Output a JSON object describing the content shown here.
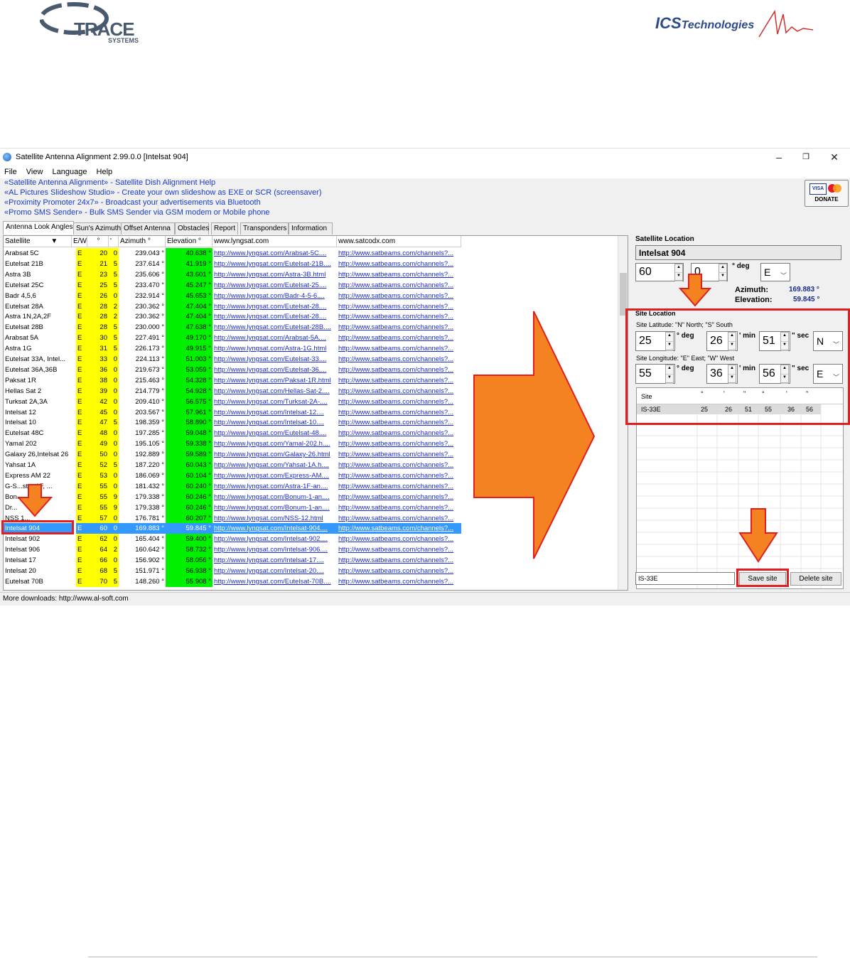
{
  "logos": {
    "trace_name": "TRACE",
    "trace_sub": "SYSTEMS",
    "ics_main": "ICS",
    "ics_rest": "Technologies"
  },
  "window": {
    "title": "Satellite Antenna Alignment 2.99.0.0 [Intelsat 904]",
    "controls": [
      "–",
      "❐",
      "✕"
    ]
  },
  "menu": [
    "File",
    "View",
    "Language",
    "Help"
  ],
  "promos": [
    "«Satellite Antenna Alignment» - Satellite Dish Alignment Help",
    "«AL Pictures Slideshow Studio» - Create your own slideshow as EXE or SCR (screensaver)",
    "«Proximity Promoter 24x7» - Broadcast your advertisements via Bluetooth",
    "«Promo SMS Sender» - Bulk SMS Sender via GSM modem or Mobile phone"
  ],
  "donate": {
    "visa": "VISA",
    "label": "DONATE"
  },
  "tabs": [
    "Antenna Look Angles",
    "Sun's Azimuth",
    "Offset Antenna",
    "Obstacles",
    "Report",
    "Transponders",
    "Information"
  ],
  "table": {
    "headers": [
      "Satellite",
      "E/W",
      "°",
      "'",
      "Azimuth °",
      "Elevation °",
      "www.lyngsat.com",
      "www.satcodx.com"
    ],
    "rows": [
      [
        "Arabsat 5C",
        "E",
        "20",
        "0",
        "239.043 °",
        "40.638 °",
        "http://www.lyngsat.com/Arabsat-5C....",
        "http://www.satbeams.com/channels?..."
      ],
      [
        "Eutelsat 21B",
        "E",
        "21",
        "5",
        "237.614 °",
        "41.919 °",
        "http://www.lyngsat.com/Eutelsat-21B....",
        "http://www.satbeams.com/channels?..."
      ],
      [
        "Astra 3B",
        "E",
        "23",
        "5",
        "235.606 °",
        "43.601 °",
        "http://www.lyngsat.com/Astra-3B.html",
        "http://www.satbeams.com/channels?..."
      ],
      [
        "Eutelsat 25C",
        "E",
        "25",
        "5",
        "233.470 °",
        "45.247 °",
        "http://www.lyngsat.com/Eutelsat-25....",
        "http://www.satbeams.com/channels?..."
      ],
      [
        "Badr 4,5,6",
        "E",
        "26",
        "0",
        "232.914 °",
        "45.653 °",
        "http://www.lyngsat.com/Badr-4-5-6....",
        "http://www.satbeams.com/channels?..."
      ],
      [
        "Eutelsat 28A",
        "E",
        "28",
        "2",
        "230.362 °",
        "47.404 °",
        "http://www.lyngsat.com/Eutelsat-28....",
        "http://www.satbeams.com/channels?..."
      ],
      [
        "Astra 1N,2A,2F",
        "E",
        "28",
        "2",
        "230.362 °",
        "47.404 °",
        "http://www.lyngsat.com/Eutelsat-28....",
        "http://www.satbeams.com/channels?..."
      ],
      [
        "Eutelsat 28B",
        "E",
        "28",
        "5",
        "230.000 °",
        "47.638 °",
        "http://www.lyngsat.com/Eutelsat-28B....",
        "http://www.satbeams.com/channels?..."
      ],
      [
        "Arabsat 5A",
        "E",
        "30",
        "5",
        "227.491 °",
        "49.170 °",
        "http://www.lyngsat.com/Arabsat-5A....",
        "http://www.satbeams.com/channels?..."
      ],
      [
        "Astra 1G",
        "E",
        "31",
        "5",
        "226.173 °",
        "49.915 °",
        "http://www.lyngsat.com/Astra-1G.html",
        "http://www.satbeams.com/channels?..."
      ],
      [
        "Eutelsat 33A, Intel...",
        "E",
        "33",
        "0",
        "224.113 °",
        "51.003 °",
        "http://www.lyngsat.com/Eutelsat-33....",
        "http://www.satbeams.com/channels?..."
      ],
      [
        "Eutelsat 36A,36B",
        "E",
        "36",
        "0",
        "219.673 °",
        "53.059 °",
        "http://www.lyngsat.com/Eutelsat-36....",
        "http://www.satbeams.com/channels?..."
      ],
      [
        "Paksat 1R",
        "E",
        "38",
        "0",
        "215.463 °",
        "54.328 °",
        "http://www.lyngsat.com/Paksat-1R.html",
        "http://www.satbeams.com/channels?..."
      ],
      [
        "Hellas Sat 2",
        "E",
        "39",
        "0",
        "214.779 °",
        "54.928 °",
        "http://www.lyngsat.com/Hellas-Sat-2....",
        "http://www.satbeams.com/channels?..."
      ],
      [
        "Turksat 2A,3A",
        "E",
        "42",
        "0",
        "209.410 °",
        "56.575 °",
        "http://www.lyngsat.com/Turksat-2A-....",
        "http://www.satbeams.com/channels?..."
      ],
      [
        "Intelsat 12",
        "E",
        "45",
        "0",
        "203.567 °",
        "57.961 °",
        "http://www.lyngsat.com/Intelsat-12....",
        "http://www.satbeams.com/channels?..."
      ],
      [
        "Intelsat 10",
        "E",
        "47",
        "5",
        "198.359 °",
        "58.890 °",
        "http://www.lyngsat.com/Intelsat-10....",
        "http://www.satbeams.com/channels?..."
      ],
      [
        "Eutelsat 48C",
        "E",
        "48",
        "0",
        "197.285 °",
        "59.048 °",
        "http://www.lyngsat.com/Eutelsat-48....",
        "http://www.satbeams.com/channels?..."
      ],
      [
        "Yamal 202",
        "E",
        "49",
        "0",
        "195.105 °",
        "59.338 °",
        "http://www.lyngsat.com/Yamal-202.h....",
        "http://www.satbeams.com/channels?..."
      ],
      [
        "Galaxy 26,Intelsat 26",
        "E",
        "50",
        "0",
        "192.889 °",
        "59.589 °",
        "http://www.lyngsat.com/Galaxy-26.html",
        "http://www.satbeams.com/channels?..."
      ],
      [
        "Yahsat 1A",
        "E",
        "52",
        "5",
        "187.220 °",
        "60.043 °",
        "http://www.lyngsat.com/Yahsat-1A.h....",
        "http://www.satbeams.com/channels?..."
      ],
      [
        "Express AM 22",
        "E",
        "53",
        "0",
        "186.069 °",
        "60.104 °",
        "http://www.lyngsat.com/Express-AM....",
        "http://www.satbeams.com/channels?..."
      ],
      [
        "G-S...stra 1F, ...",
        "E",
        "55",
        "0",
        "181.432 °",
        "60.240 °",
        "http://www.lyngsat.com/Astra-1F-an....",
        "http://www.satbeams.com/channels?..."
      ],
      [
        "Bon...",
        "E",
        "55",
        "9",
        "179.338 °",
        "60.246 °",
        "http://www.lyngsat.com/Bonum-1-an....",
        "http://www.satbeams.com/channels?..."
      ],
      [
        "Dr...",
        "E",
        "55",
        "9",
        "179.338 °",
        "60.246 °",
        "http://www.lyngsat.com/Bonum-1-an....",
        "http://www.satbeams.com/channels?..."
      ],
      [
        "NSS 1...",
        "E",
        "57",
        "0",
        "176.781 °",
        "60.207 °",
        "http://www.lyngsat.com/NSS-12.html",
        "http://www.satbeams.com/channels?..."
      ],
      [
        "Intelsat 904",
        "E",
        "60",
        "0",
        "169.883 °",
        "59.845 °",
        "http://www.lyngsat.com/Intelsat-904....",
        "http://www.satbeams.com/channels?..."
      ],
      [
        "Intelsat 902",
        "E",
        "62",
        "0",
        "165.404 °",
        "59.400 °",
        "http://www.lyngsat.com/Intelsat-902....",
        "http://www.satbeams.com/channels?..."
      ],
      [
        "Intelsat 906",
        "E",
        "64",
        "2",
        "160.642 °",
        "58.732 °",
        "http://www.lyngsat.com/Intelsat-906....",
        "http://www.satbeams.com/channels?..."
      ],
      [
        "Intelsat 17",
        "E",
        "66",
        "0",
        "156.902 °",
        "58.056 °",
        "http://www.lyngsat.com/Intelsat-17....",
        "http://www.satbeams.com/channels?..."
      ],
      [
        "Intelsat 20",
        "E",
        "68",
        "5",
        "151.971 °",
        "56.938 °",
        "http://www.lyngsat.com/Intelsat-20....",
        "http://www.satbeams.com/channels?..."
      ],
      [
        "Eutelsat 70B",
        "E",
        "70",
        "5",
        "148.260 °",
        "55.908 °",
        "http://www.lyngsat.com/Eutelsat-70B....",
        "http://www.satbeams.com/channels?..."
      ]
    ],
    "selected_index": 26
  },
  "sat_location": {
    "label": "Satellite Location",
    "name": "Intelsat 904",
    "deg": "60",
    "min": "0",
    "deg_unit": "° deg",
    "dir": "E",
    "azimuth_label": "Azimuth:",
    "azimuth": "169.883 °",
    "elevation_label": "Elevation:",
    "elevation": "59.845 °"
  },
  "site_location": {
    "label": "Site Location",
    "lat_label": "Site Latitude:  \"N\" North; \"S\" South",
    "lat_deg": "25",
    "lat_min": "26",
    "lat_sec": "51",
    "lat_dir": "N",
    "lon_label": "Site Longitude:  \"E\" East; \"W\" West",
    "lon_deg": "55",
    "lon_min": "36",
    "lon_sec": "56",
    "lon_dir": "E",
    "u_deg": "° deg",
    "u_min": "' min",
    "u_sec": "\" sec"
  },
  "sites_table": {
    "headers": [
      "Site",
      "°",
      "'",
      "\"",
      "°",
      "'",
      "\""
    ],
    "rows": [
      [
        "IS-33E",
        "25",
        "26",
        "51",
        "55",
        "36",
        "56"
      ]
    ]
  },
  "site_name_input": "IS-33E",
  "buttons": {
    "save": "Save site",
    "delete": "Delete site"
  },
  "status": "More downloads: http://www.al-soft.com",
  "colors": {
    "arrow": "#f58220",
    "highlight": "#e02020",
    "link": "#1a2ccf",
    "yellow": "#ffff00",
    "green": "#00f000",
    "selection": "#3399ff"
  }
}
